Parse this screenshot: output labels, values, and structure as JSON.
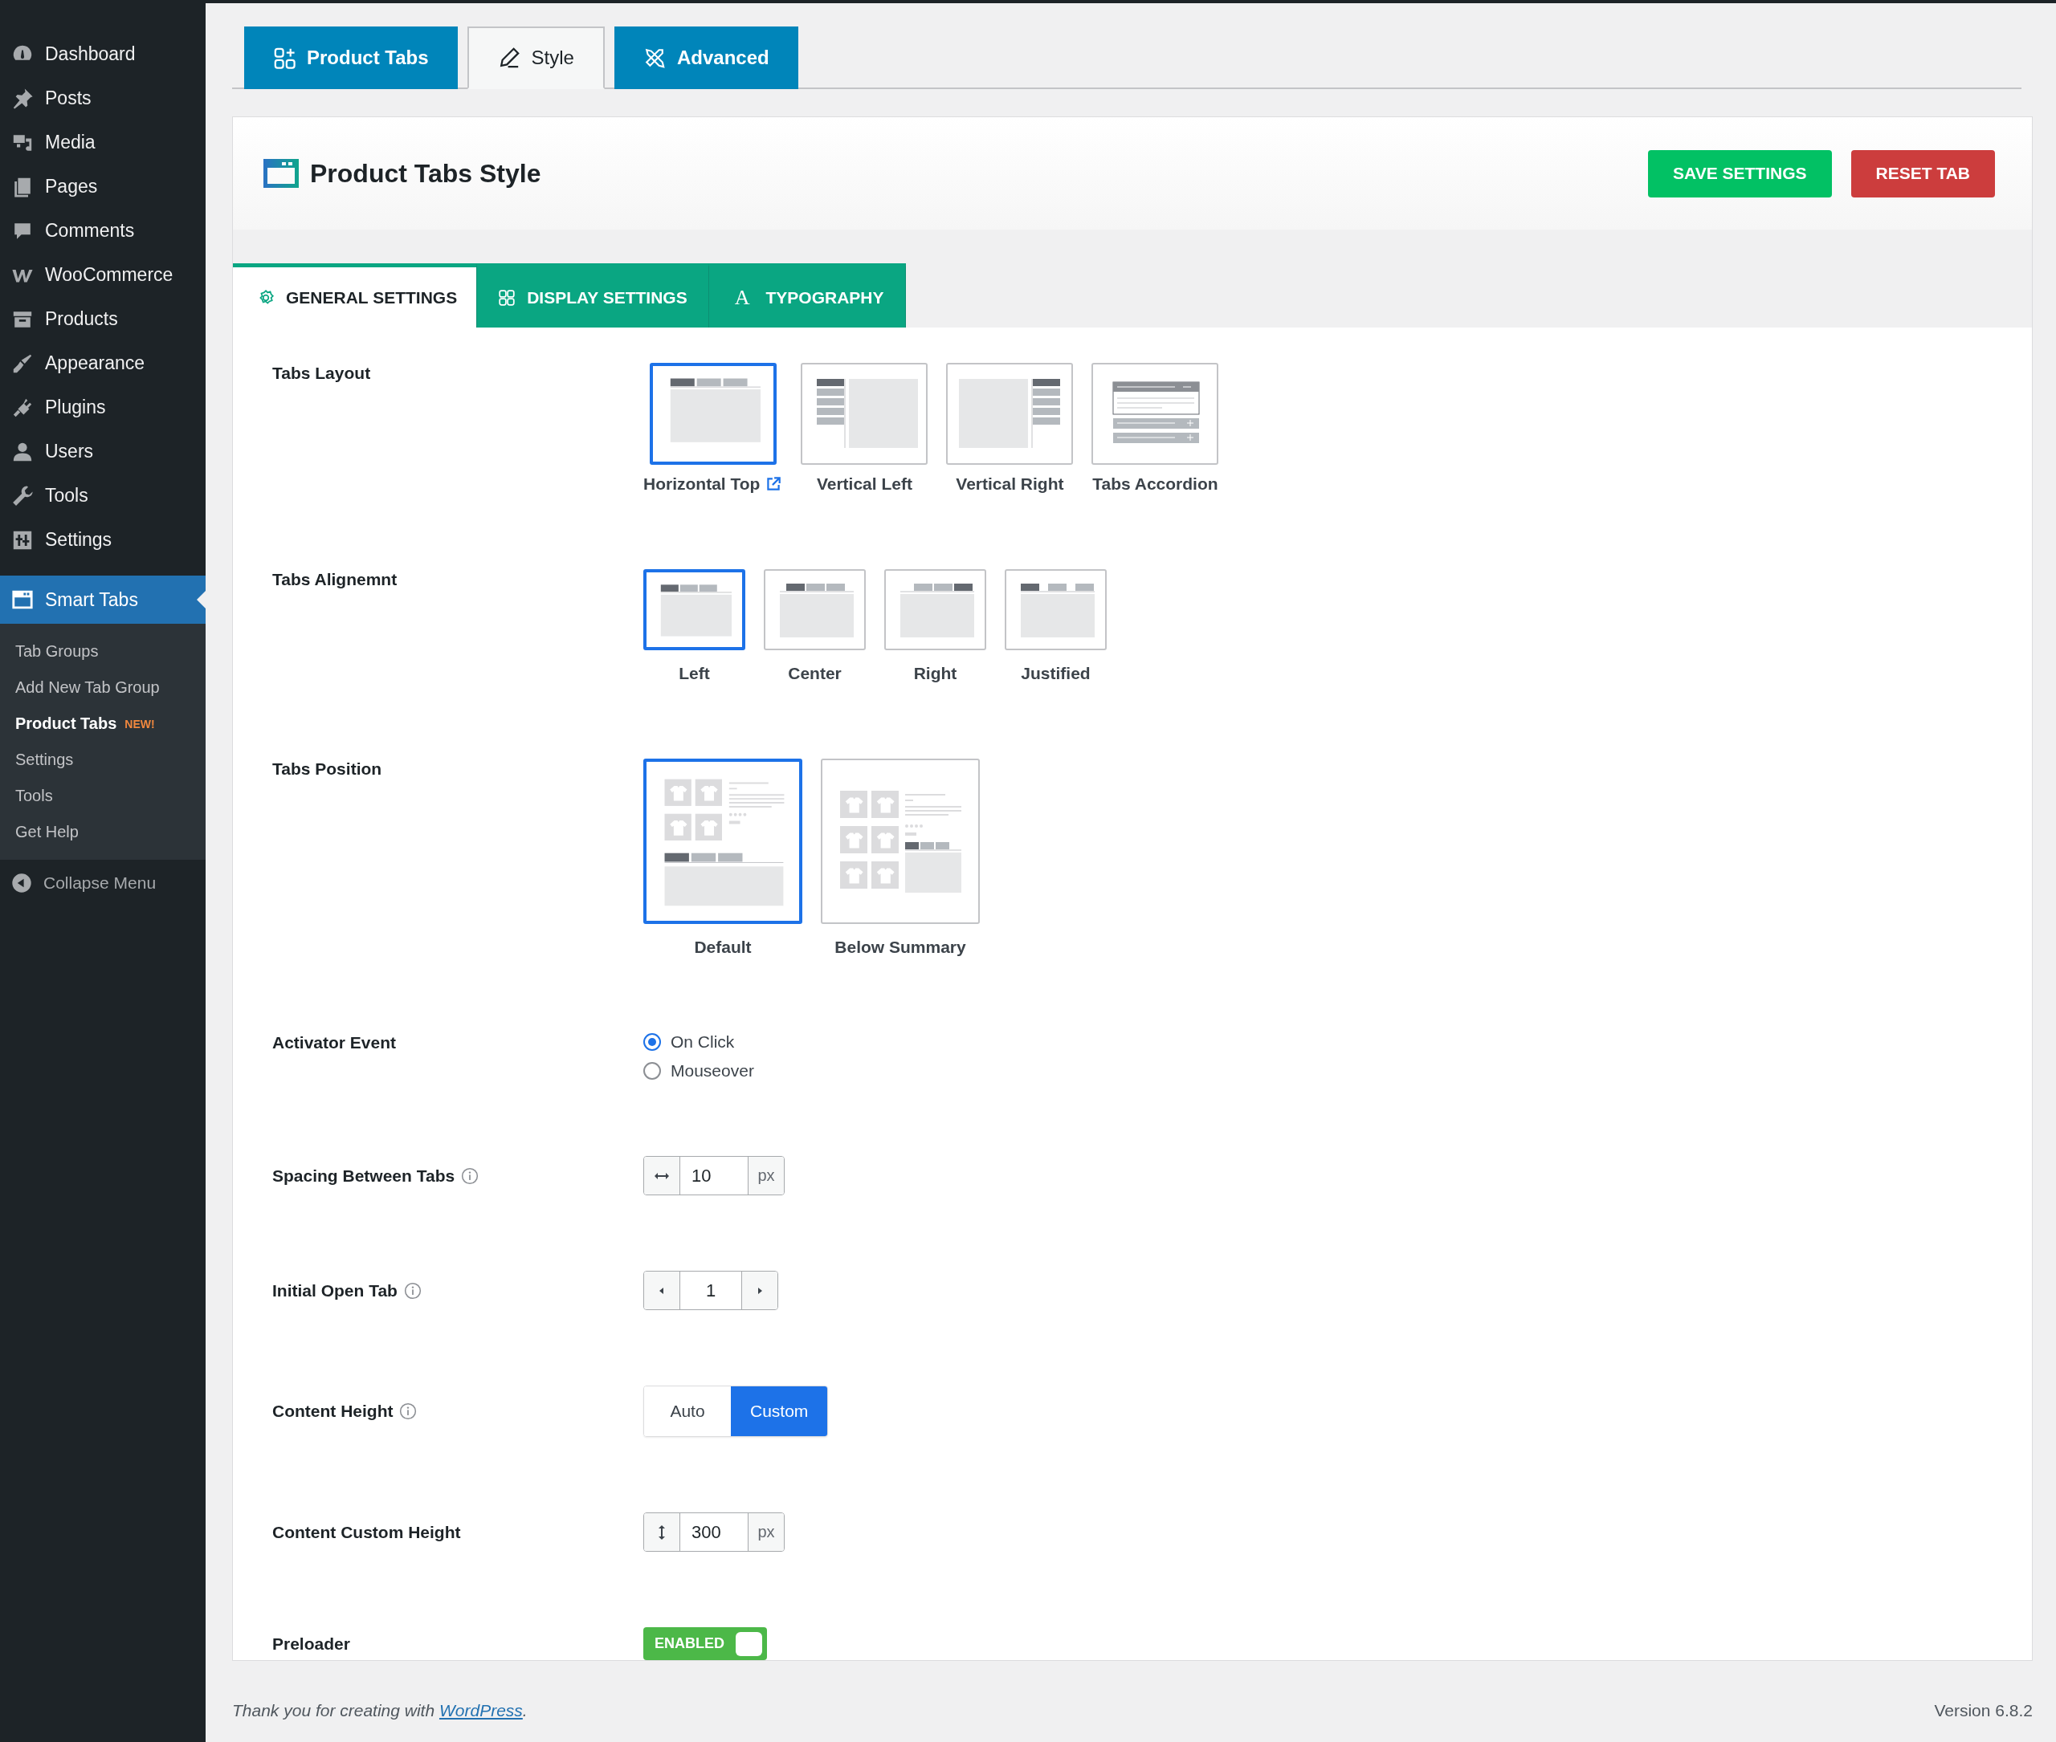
{
  "sidebar": {
    "items": [
      {
        "label": "Dashboard",
        "selected": false
      },
      {
        "label": "Posts",
        "selected": false
      },
      {
        "label": "Media",
        "selected": false
      },
      {
        "label": "Pages",
        "selected": false
      },
      {
        "label": "Comments",
        "selected": false
      },
      {
        "label": "WooCommerce",
        "selected": false
      },
      {
        "label": "Products",
        "selected": false
      },
      {
        "label": "Appearance",
        "selected": false
      },
      {
        "label": "Plugins",
        "selected": false
      },
      {
        "label": "Users",
        "selected": false
      },
      {
        "label": "Tools",
        "selected": false
      },
      {
        "label": "Settings",
        "selected": false
      },
      {
        "label": "Smart Tabs",
        "selected": true
      }
    ],
    "submenu": [
      {
        "label": "Tab Groups",
        "selected": false
      },
      {
        "label": "Add New Tab Group",
        "selected": false
      },
      {
        "label": "Product Tabs",
        "selected": true,
        "badge": "NEW!"
      },
      {
        "label": "Settings",
        "selected": false
      },
      {
        "label": "Tools",
        "selected": false
      },
      {
        "label": "Get Help",
        "selected": false
      }
    ],
    "collapse": "Collapse Menu"
  },
  "top_tabs": [
    {
      "label": "Product Tabs",
      "selected": false
    },
    {
      "label": "Style",
      "selected": true
    },
    {
      "label": "Advanced",
      "selected": false
    }
  ],
  "header": {
    "title": "Product Tabs Style",
    "buttons": [
      {
        "label": "SAVE SETTINGS",
        "kind": "save"
      },
      {
        "label": "RESET TAB",
        "kind": "reset"
      }
    ]
  },
  "section_tabs": [
    {
      "label": "GENERAL SETTINGS",
      "selected": true
    },
    {
      "label": "DISPLAY SETTINGS",
      "selected": false
    },
    {
      "label": "TYPOGRAPHY",
      "selected": false,
      "icon_text": "A"
    }
  ],
  "settings": [
    {
      "kind": "layout",
      "label": "Tabs Layout",
      "options": [
        {
          "label": "Horizontal Top",
          "kind": "top",
          "selected": true,
          "external_link": true
        },
        {
          "label": "Vertical Left",
          "kind": "left",
          "selected": false
        },
        {
          "label": "Vertical Right",
          "kind": "right",
          "selected": false
        },
        {
          "label": "Tabs Accordion",
          "kind": "accordion",
          "selected": false
        }
      ]
    },
    {
      "kind": "alignment",
      "label": "Tabs Alignemnt",
      "options": [
        {
          "label": "Left",
          "kind": "left",
          "selected": true
        },
        {
          "label": "Center",
          "kind": "center",
          "selected": false
        },
        {
          "label": "Right",
          "kind": "right",
          "selected": false
        },
        {
          "label": "Justified",
          "kind": "justified",
          "selected": false
        }
      ]
    },
    {
      "kind": "position",
      "label": "Tabs Position",
      "options": [
        {
          "label": "Default",
          "kind": "default",
          "selected": true
        },
        {
          "label": "Below Summary",
          "kind": "below",
          "selected": false
        }
      ]
    },
    {
      "kind": "radio",
      "label": "Activator Event",
      "options": [
        {
          "label": "On Click",
          "selected": true
        },
        {
          "label": "Mouseover",
          "selected": false
        }
      ]
    },
    {
      "kind": "width_input",
      "label": "Spacing Between Tabs",
      "info": true,
      "value": "10",
      "unit": "px"
    },
    {
      "kind": "stepper",
      "label": "Initial Open Tab",
      "info": true,
      "value": "1"
    },
    {
      "kind": "segmented",
      "label": "Content Height",
      "info": true,
      "options": [
        {
          "label": "Auto",
          "selected": false
        },
        {
          "label": "Custom",
          "selected": true
        }
      ]
    },
    {
      "kind": "height_input",
      "label": "Content Custom Height",
      "value": "300",
      "unit": "px"
    },
    {
      "kind": "toggle",
      "label": "Preloader",
      "on": true,
      "text": "ENABLED"
    }
  ],
  "footer": {
    "text": "Thank you for creating with ",
    "link": "WordPress",
    "suffix": ".",
    "version": "Version 6.8.2"
  }
}
